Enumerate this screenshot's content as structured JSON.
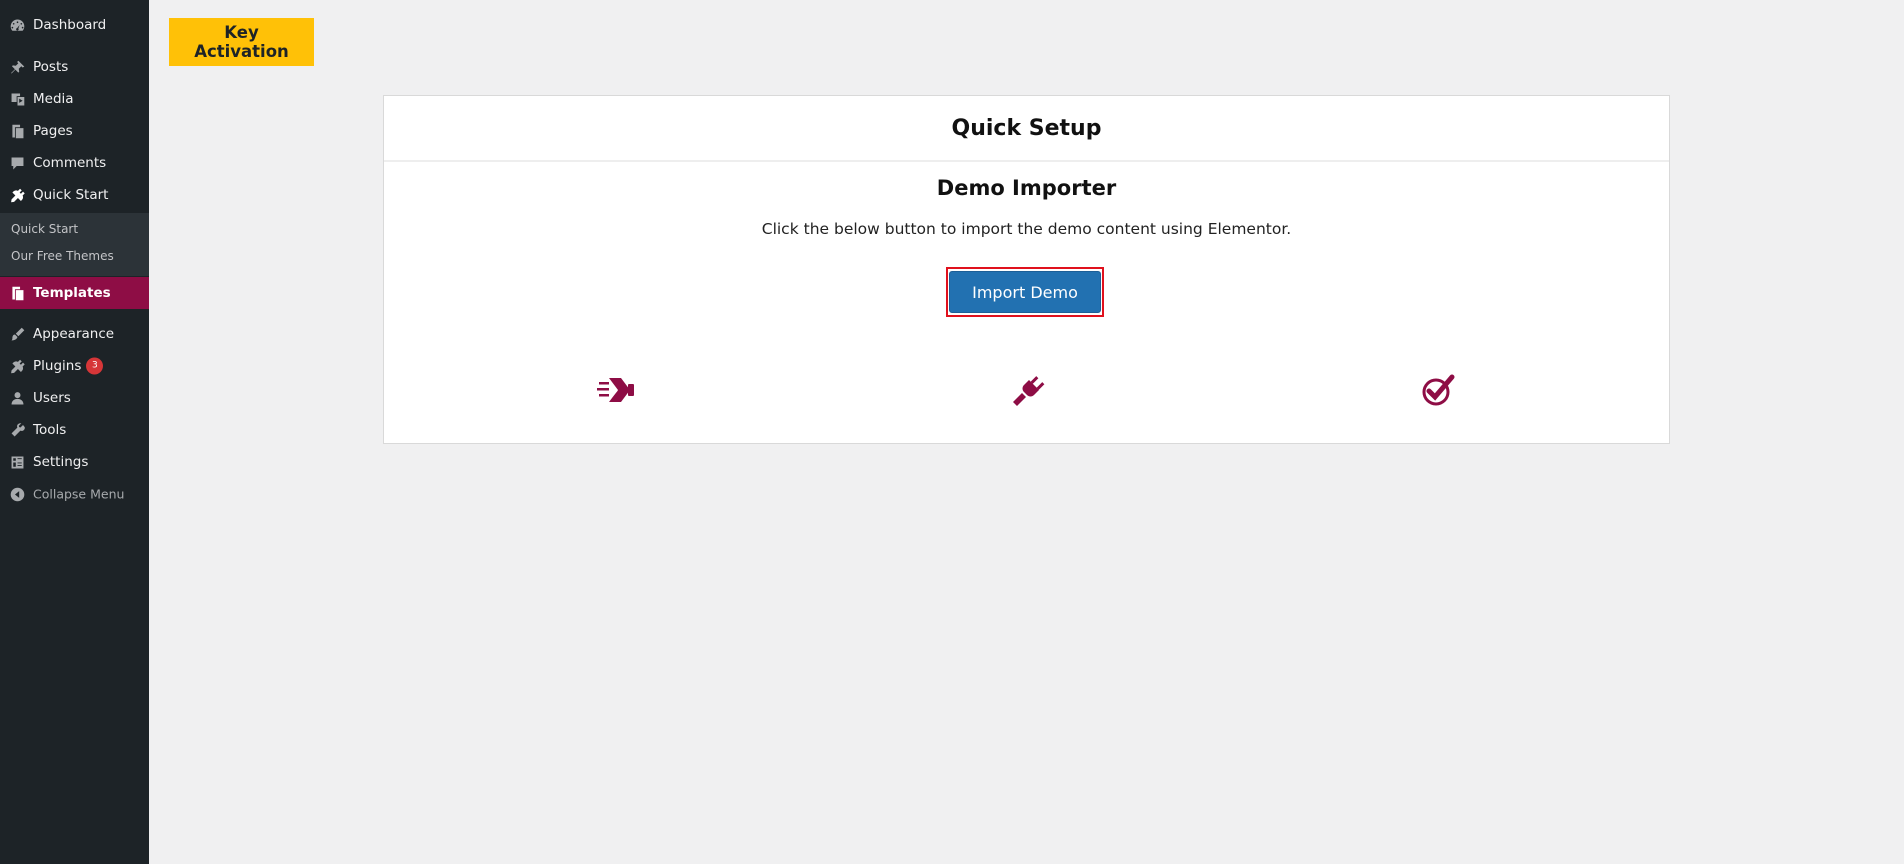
{
  "sidebar": {
    "items": [
      {
        "label": "Dashboard",
        "icon": "dashboard-icon"
      },
      {
        "label": "Posts",
        "icon": "pin-icon"
      },
      {
        "label": "Media",
        "icon": "media-icon"
      },
      {
        "label": "Pages",
        "icon": "pages-icon"
      },
      {
        "label": "Comments",
        "icon": "comment-icon"
      },
      {
        "label": "Quick Start",
        "icon": "plugin-icon"
      },
      {
        "label": "Templates",
        "icon": "pages-icon"
      },
      {
        "label": "Appearance",
        "icon": "brush-icon"
      },
      {
        "label": "Plugins",
        "icon": "plugin-icon",
        "badge": "3"
      },
      {
        "label": "Users",
        "icon": "user-icon"
      },
      {
        "label": "Tools",
        "icon": "wrench-icon"
      },
      {
        "label": "Settings",
        "icon": "settings-icon"
      },
      {
        "label": "Collapse Menu",
        "icon": "collapse-icon"
      }
    ],
    "submenu": [
      {
        "label": "Quick Start"
      },
      {
        "label": "Our Free Themes"
      }
    ],
    "active_color": "#8e0d45"
  },
  "header": {
    "key_activation_label": "Key Activation",
    "key_activation_color": "#ffc107"
  },
  "card": {
    "title": "Quick Setup",
    "demo_title": "Demo Importer",
    "demo_description": "Click the below button to import the demo content using Elementor.",
    "import_button_label": "Import Demo",
    "import_button_color": "#2271b1",
    "highlight_color": "#e0111d",
    "step_icons": [
      "import-arrow-icon",
      "plug-icon",
      "check-icon"
    ],
    "icon_color": "#8e0d45"
  }
}
